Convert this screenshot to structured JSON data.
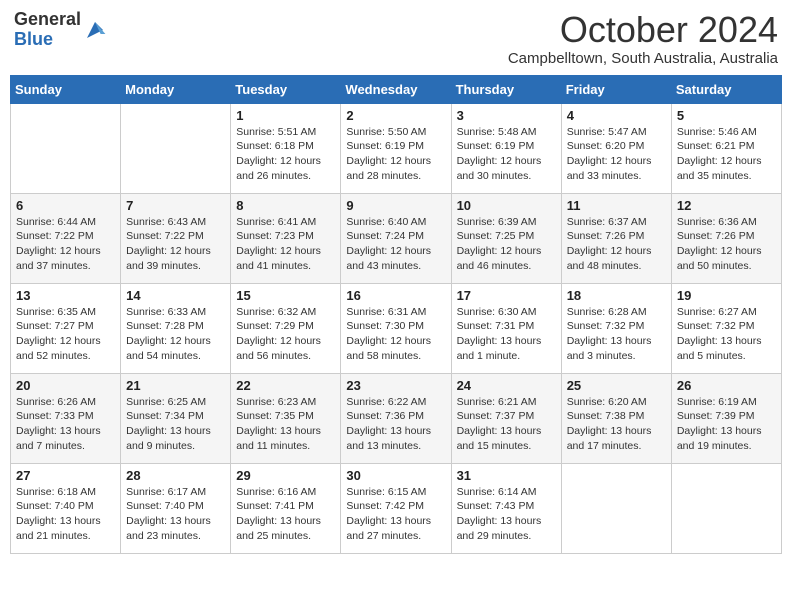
{
  "header": {
    "logo_general": "General",
    "logo_blue": "Blue",
    "month_title": "October 2024",
    "location": "Campbelltown, South Australia, Australia"
  },
  "weekdays": [
    "Sunday",
    "Monday",
    "Tuesday",
    "Wednesday",
    "Thursday",
    "Friday",
    "Saturday"
  ],
  "weeks": [
    [
      {
        "num": "",
        "info": ""
      },
      {
        "num": "",
        "info": ""
      },
      {
        "num": "1",
        "info": "Sunrise: 5:51 AM\nSunset: 6:18 PM\nDaylight: 12 hours\nand 26 minutes."
      },
      {
        "num": "2",
        "info": "Sunrise: 5:50 AM\nSunset: 6:19 PM\nDaylight: 12 hours\nand 28 minutes."
      },
      {
        "num": "3",
        "info": "Sunrise: 5:48 AM\nSunset: 6:19 PM\nDaylight: 12 hours\nand 30 minutes."
      },
      {
        "num": "4",
        "info": "Sunrise: 5:47 AM\nSunset: 6:20 PM\nDaylight: 12 hours\nand 33 minutes."
      },
      {
        "num": "5",
        "info": "Sunrise: 5:46 AM\nSunset: 6:21 PM\nDaylight: 12 hours\nand 35 minutes."
      }
    ],
    [
      {
        "num": "6",
        "info": "Sunrise: 6:44 AM\nSunset: 7:22 PM\nDaylight: 12 hours\nand 37 minutes."
      },
      {
        "num": "7",
        "info": "Sunrise: 6:43 AM\nSunset: 7:22 PM\nDaylight: 12 hours\nand 39 minutes."
      },
      {
        "num": "8",
        "info": "Sunrise: 6:41 AM\nSunset: 7:23 PM\nDaylight: 12 hours\nand 41 minutes."
      },
      {
        "num": "9",
        "info": "Sunrise: 6:40 AM\nSunset: 7:24 PM\nDaylight: 12 hours\nand 43 minutes."
      },
      {
        "num": "10",
        "info": "Sunrise: 6:39 AM\nSunset: 7:25 PM\nDaylight: 12 hours\nand 46 minutes."
      },
      {
        "num": "11",
        "info": "Sunrise: 6:37 AM\nSunset: 7:26 PM\nDaylight: 12 hours\nand 48 minutes."
      },
      {
        "num": "12",
        "info": "Sunrise: 6:36 AM\nSunset: 7:26 PM\nDaylight: 12 hours\nand 50 minutes."
      }
    ],
    [
      {
        "num": "13",
        "info": "Sunrise: 6:35 AM\nSunset: 7:27 PM\nDaylight: 12 hours\nand 52 minutes."
      },
      {
        "num": "14",
        "info": "Sunrise: 6:33 AM\nSunset: 7:28 PM\nDaylight: 12 hours\nand 54 minutes."
      },
      {
        "num": "15",
        "info": "Sunrise: 6:32 AM\nSunset: 7:29 PM\nDaylight: 12 hours\nand 56 minutes."
      },
      {
        "num": "16",
        "info": "Sunrise: 6:31 AM\nSunset: 7:30 PM\nDaylight: 12 hours\nand 58 minutes."
      },
      {
        "num": "17",
        "info": "Sunrise: 6:30 AM\nSunset: 7:31 PM\nDaylight: 13 hours\nand 1 minute."
      },
      {
        "num": "18",
        "info": "Sunrise: 6:28 AM\nSunset: 7:32 PM\nDaylight: 13 hours\nand 3 minutes."
      },
      {
        "num": "19",
        "info": "Sunrise: 6:27 AM\nSunset: 7:32 PM\nDaylight: 13 hours\nand 5 minutes."
      }
    ],
    [
      {
        "num": "20",
        "info": "Sunrise: 6:26 AM\nSunset: 7:33 PM\nDaylight: 13 hours\nand 7 minutes."
      },
      {
        "num": "21",
        "info": "Sunrise: 6:25 AM\nSunset: 7:34 PM\nDaylight: 13 hours\nand 9 minutes."
      },
      {
        "num": "22",
        "info": "Sunrise: 6:23 AM\nSunset: 7:35 PM\nDaylight: 13 hours\nand 11 minutes."
      },
      {
        "num": "23",
        "info": "Sunrise: 6:22 AM\nSunset: 7:36 PM\nDaylight: 13 hours\nand 13 minutes."
      },
      {
        "num": "24",
        "info": "Sunrise: 6:21 AM\nSunset: 7:37 PM\nDaylight: 13 hours\nand 15 minutes."
      },
      {
        "num": "25",
        "info": "Sunrise: 6:20 AM\nSunset: 7:38 PM\nDaylight: 13 hours\nand 17 minutes."
      },
      {
        "num": "26",
        "info": "Sunrise: 6:19 AM\nSunset: 7:39 PM\nDaylight: 13 hours\nand 19 minutes."
      }
    ],
    [
      {
        "num": "27",
        "info": "Sunrise: 6:18 AM\nSunset: 7:40 PM\nDaylight: 13 hours\nand 21 minutes."
      },
      {
        "num": "28",
        "info": "Sunrise: 6:17 AM\nSunset: 7:40 PM\nDaylight: 13 hours\nand 23 minutes."
      },
      {
        "num": "29",
        "info": "Sunrise: 6:16 AM\nSunset: 7:41 PM\nDaylight: 13 hours\nand 25 minutes."
      },
      {
        "num": "30",
        "info": "Sunrise: 6:15 AM\nSunset: 7:42 PM\nDaylight: 13 hours\nand 27 minutes."
      },
      {
        "num": "31",
        "info": "Sunrise: 6:14 AM\nSunset: 7:43 PM\nDaylight: 13 hours\nand 29 minutes."
      },
      {
        "num": "",
        "info": ""
      },
      {
        "num": "",
        "info": ""
      }
    ]
  ]
}
